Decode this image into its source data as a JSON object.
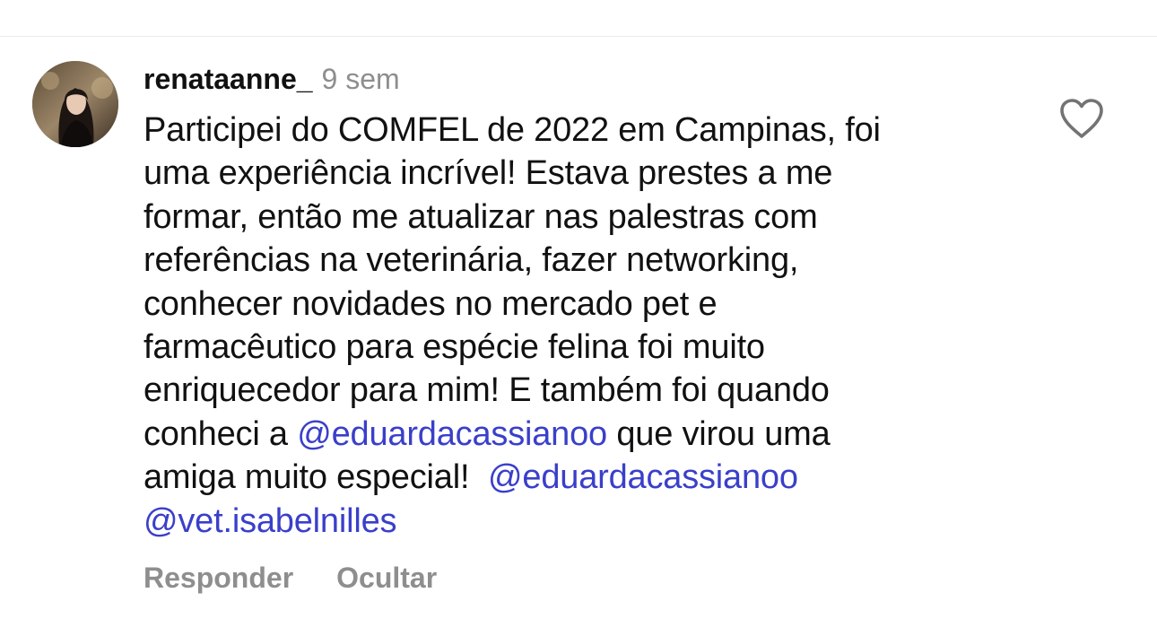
{
  "comment": {
    "username": "renataanne_",
    "timestamp": "9 sem",
    "body_lines": [
      "Participei do COMFEL de 2022 em Campinas, foi",
      "uma experiência incrível! Estava prestes a me",
      "formar, então me atualizar nas palestras com",
      "referências na veterinária, fazer networking,",
      "conhecer novidades no mercado pet e",
      "farmacêutico para espécie felina foi muito",
      "enriquecedor para mim! E também foi quando"
    ],
    "line8_before": "conheci a ",
    "mention_1": "@eduardacassianoo",
    "line8_after": " que virou uma",
    "line9_before": "amiga muito especial!  ",
    "mention_2": "@eduardacassianoo",
    "mention_3": "@vet.isabelnilles",
    "like_icon": "heart-outline-icon",
    "actions": {
      "reply": "Responder",
      "hide": "Ocultar"
    }
  },
  "colors": {
    "text": "#111111",
    "secondary": "#8e8e8e",
    "mention": "#3a3fca",
    "divider": "#ececec",
    "background": "#ffffff"
  }
}
